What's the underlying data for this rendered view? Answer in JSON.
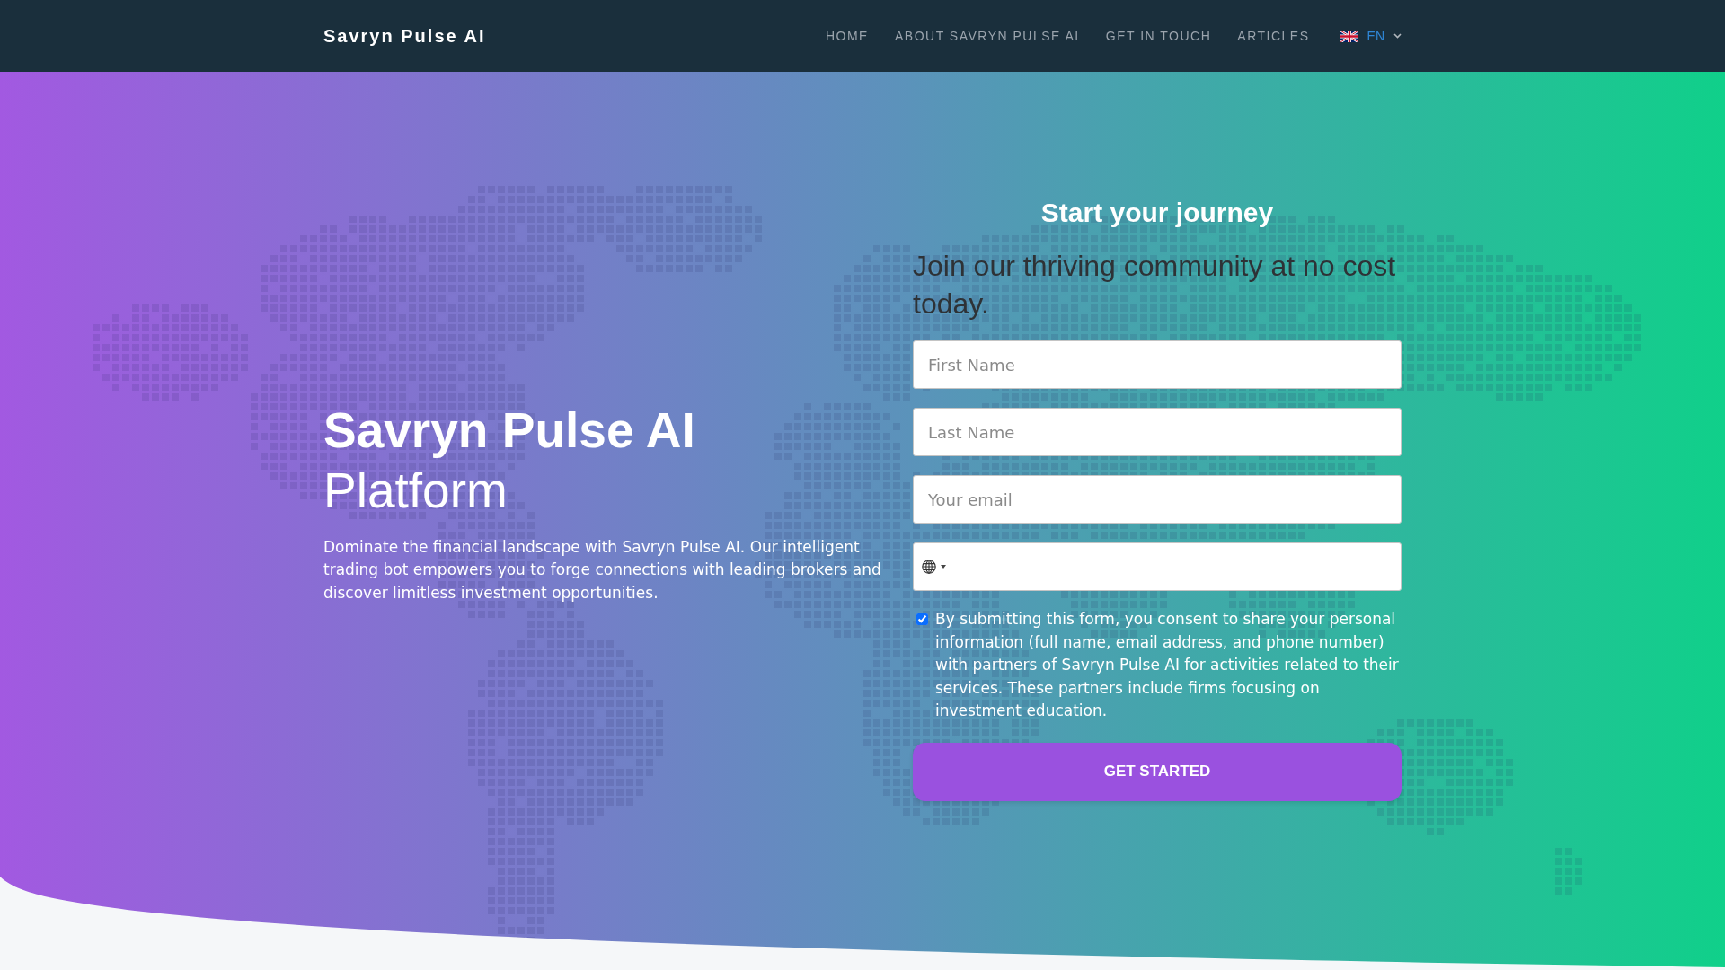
{
  "navbar": {
    "brand": "Savryn Pulse AI",
    "links": [
      {
        "label": "HOME"
      },
      {
        "label": "ABOUT SAVRYN PULSE AI"
      },
      {
        "label": "GET IN TOUCH"
      },
      {
        "label": "ARTICLES"
      }
    ],
    "language": {
      "label": "EN"
    }
  },
  "hero": {
    "title": "**Savryn Pulse AI** Platform",
    "description": "Dominate the financial landscape with Savryn Pulse AI. Our intelligent trading bot empowers you to forge connections with leading brokers and discover limitless investment opportunities."
  },
  "signup_form": {
    "title": "Start your journey",
    "subtitle": "Join our thriving community at no cost today.",
    "fields": [
      {
        "kind": "text",
        "placeholder": "First Name"
      },
      {
        "kind": "text",
        "placeholder": "Last Name"
      },
      {
        "kind": "text",
        "placeholder": "Your email"
      },
      {
        "kind": "phone"
      }
    ],
    "consent": {
      "checked": true,
      "text": "By submitting this form, you consent to share your personal information (full name, email address, and phone number) with partners of Savryn Pulse AI for activities related to their services. These partners include firms focusing on investment education."
    },
    "submit": "GET STARTED"
  }
}
